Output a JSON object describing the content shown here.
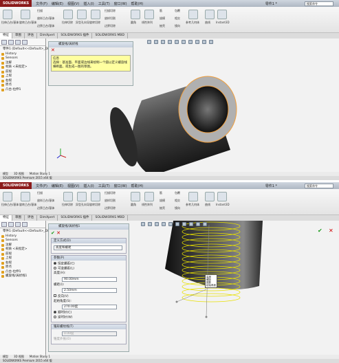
{
  "app": {
    "logo": "SOLIDWORKS",
    "menu": [
      "文件(F)",
      "编辑(E)",
      "视图(V)",
      "插入(I)",
      "工具(T)",
      "窗口(W)",
      "帮助(H)"
    ],
    "title": "零件1 *",
    "search_placeholder": "搜索命令"
  },
  "ribbon": {
    "labels": [
      "拉伸凸台/基体",
      "旋转凸台/基体",
      "扫描",
      "放样凸台/基体",
      "边界凸台/基体",
      "拉伸切除",
      "异型孔向导",
      "旋转切除",
      "扫描切除",
      "放样切割",
      "边界切除",
      "圆角",
      "线性阵列",
      "筋",
      "拔模",
      "抽壳",
      "包覆",
      "相交",
      "镜向",
      "参考几何体",
      "曲线",
      "Instant3D"
    ]
  },
  "cm_tabs": [
    "特征",
    "草图",
    "评估",
    "DimXpert",
    "SOLIDWORKS 插件",
    "SOLIDWORKS MBD"
  ],
  "tree": {
    "items": [
      "零件1 (Default<<Default>_Di",
      "History",
      "Sensors",
      "注解",
      "材质 <未指定>",
      "前视",
      "上视",
      "右视",
      "原点",
      "凸台-拉伸1"
    ],
    "extra_item_2": "螺旋线/涡状线1"
  },
  "panel1": {
    "title": "螺旋线/涡状线",
    "help_title": "信息",
    "help_text": "选择：基准面、平面或边线来绘制一个圆以定义螺旋线横断面。或生成一图的草图。"
  },
  "panel2": {
    "title": "螺旋线/涡状线1",
    "section_define": "定义方式(D)",
    "define_value": "高度和螺距",
    "section_params": "参数(P)",
    "opt_const": "恒定螺距(C)",
    "opt_var": "可变螺距(L)",
    "label_height": "高度(H):",
    "value_height": "90.00mm",
    "label_pitch": "螺距(I):",
    "value_pitch": "2.50mm",
    "label_reverse": "反向(V)",
    "label_start": "起始角度(S):",
    "value_start": "270.00度",
    "opt_cw": "顺时针(C)",
    "opt_ccw": "逆时针(W)",
    "section_taper": "锥形螺纹线(T)",
    "taper_value": "0.00度",
    "taper_outward": "锥度外张(O)"
  },
  "status": {
    "line1": "SOLIDWORKS Premium 2015 x64 版",
    "tabs": [
      "模型",
      "3D 视图",
      "Motion Study 1"
    ]
  },
  "annotation": {
    "rows": [
      "高度",
      "螺距",
      "圈数",
      "起始角度"
    ]
  },
  "colors": {
    "helix": "#e8e000",
    "cylinder_dark": "#2a2a2a",
    "selection": "#f0a040",
    "help_bg": "#ffffa0"
  }
}
